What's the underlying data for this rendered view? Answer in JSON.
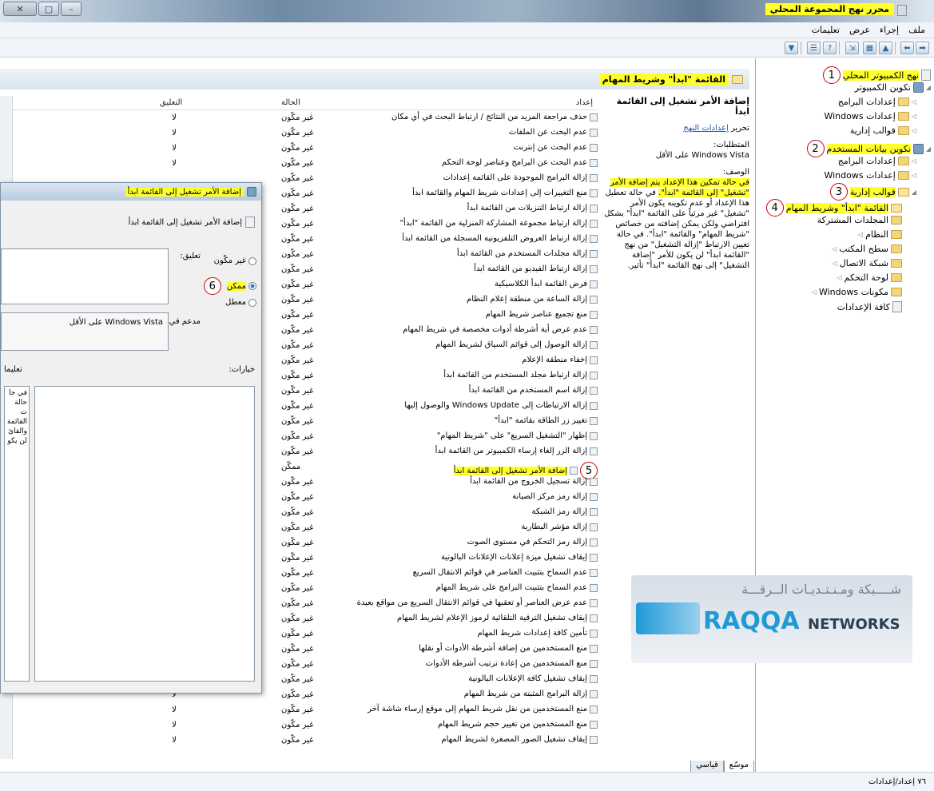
{
  "window": {
    "title": "محرر نهج المجموعة المحلي"
  },
  "menu": [
    "ملف",
    "إجراء",
    "عرض",
    "تعليمات"
  ],
  "tree": [
    {
      "label": "نهج الكمبيوتر المحلي",
      "highlight": true,
      "marker": "1"
    },
    {
      "label": "تكوين الكمبيوتر"
    },
    {
      "label": "إعدادات البرامج"
    },
    {
      "label": "إعدادات Windows"
    },
    {
      "label": "قوالب إدارية"
    },
    {
      "label": "تكوين بيانات المستخدم",
      "highlight": true,
      "marker": "2"
    },
    {
      "label": "إعدادات البرامج"
    },
    {
      "label": "إعدادات Windows"
    },
    {
      "label": "قوالب إدارية",
      "highlight": true,
      "marker": "3"
    },
    {
      "label": "القائمة \"ابدأ\" وشريط المهام",
      "highlight": true,
      "marker": "4"
    },
    {
      "label": "المجلدات المشتركة"
    },
    {
      "label": "النظام"
    },
    {
      "label": "سطح المكتب"
    },
    {
      "label": "شبكة الاتصال"
    },
    {
      "label": "لوحة التحكم"
    },
    {
      "label": "مكونات Windows"
    },
    {
      "label": "كافة الإعدادات"
    }
  ],
  "content": {
    "header_title": "القائمة \"ابدأ\" وشريط المهام",
    "desc": {
      "setting_title": "إضافة الأمر تشغيل إلى القائمة ابدأ",
      "edit_prefix": "تحرير",
      "edit_link": "إعدادات النهج",
      "requirements_label": "المتطلبات:",
      "requirements_value": "Windows Vista على الأقل",
      "description_label": "الوصف:",
      "description_highlight": "في حالة تمكين هذا الإعداد يتم إضافة الأمر \"تشغيل\" إلى القائمة \"ابدأ\".",
      "description_rest": "في حالة تعطيل هذا الإعداد أو عدم تكوينه يكون الأمر \"تشغيل\" غير مرئياً على القائمة \"ابدأ\" بشكل افتراضي ولكن يمكن إضافته من خصائص \"شريط المهام\" والقائمة \"ابدأ\". في حالة تعيين الارتباط \"إزالة التشغيل\" من نهج \"القائمة ابدأ\" لن يكون للأمر \"إضافة التشغيل\" إلى نهج القائمة \"ابدأ\" تأثير."
    },
    "columns": {
      "setting": "إعداد",
      "state": "الحالة",
      "comment": "التعليق"
    },
    "rows": [
      {
        "setting": "حذف مراجعة المزيد من النتائج / ارتباط البحث في أي مكان",
        "state": "غير مكّون",
        "comment": "لا"
      },
      {
        "setting": "عدم البحث عن الملفات",
        "state": "غير مكّون",
        "comment": "لا"
      },
      {
        "setting": "عدم البحث عن إنترنت",
        "state": "غير مكّون",
        "comment": "لا"
      },
      {
        "setting": "عدم البحث عن البرامج وعناصر لوحة التحكم",
        "state": "غير مكّون",
        "comment": "لا"
      },
      {
        "setting": "إزالة البرامج الموجودة على القائمة إعدادات",
        "state": "غير مكّون",
        "comment": ""
      },
      {
        "setting": "منع التغييرات إلى إعدادات شريط المهام والقائمة ابدأ",
        "state": "غير مكّون",
        "comment": ""
      },
      {
        "setting": "إزالة ارتباط التنزيلات من القائمة ابدأ",
        "state": "غير مكّون",
        "comment": ""
      },
      {
        "setting": "إزالة ارتباط مجموعة المشاركة المنزلية من القائمة \"ابدأ\"",
        "state": "غير مكّون",
        "comment": ""
      },
      {
        "setting": "إزالة ارتباط العروض التلفزيونية المسجلة من القائمة ابدأ",
        "state": "غير مكّون",
        "comment": ""
      },
      {
        "setting": "إزالة مجلدات المستخدم من القائمة ابدأ",
        "state": "غير مكّون",
        "comment": ""
      },
      {
        "setting": "إزالة ارتباط الفيديو من القائمة ابدأ",
        "state": "غير مكّون",
        "comment": ""
      },
      {
        "setting": "فرض القائمة ابدأ الكلاسيكية",
        "state": "غير مكّون",
        "comment": ""
      },
      {
        "setting": "إزالة الساعة من منطقة إعلام النظام",
        "state": "غير مكّون",
        "comment": ""
      },
      {
        "setting": "منع تجميع عناصر شريط المهام",
        "state": "غير مكّون",
        "comment": ""
      },
      {
        "setting": "عدم عرض أية أشرطة أدوات مخصصة في شريط المهام",
        "state": "غير مكّون",
        "comment": ""
      },
      {
        "setting": "إزالة الوصول إلى قوائم السياق لشريط المهام",
        "state": "غير مكّون",
        "comment": ""
      },
      {
        "setting": "إخفاء منطقة الإعلام",
        "state": "غير مكّون",
        "comment": ""
      },
      {
        "setting": "إزالة ارتباط مجلد المستخدم من القائمة ابدأ",
        "state": "غير مكّون",
        "comment": ""
      },
      {
        "setting": "إزالة اسم المستخدم من القائمة ابدأ",
        "state": "غير مكّون",
        "comment": ""
      },
      {
        "setting": "إزالة الارتباطات إلى Windows Update والوصول إليها",
        "state": "غير مكّون",
        "comment": ""
      },
      {
        "setting": "تغيير زر الطاقة بقائمة \"ابدأ\"",
        "state": "غير مكّون",
        "comment": ""
      },
      {
        "setting": "إظهار \"التشغيل السريع\" على \"شريط المهام\"",
        "state": "غير مكّون",
        "comment": ""
      },
      {
        "setting": "إزالة الزر إلغاء إرساء الكمبيوتر من القائمة ابدأ",
        "state": "غير مكّون",
        "comment": ""
      },
      {
        "setting": "إضافة الأمر تشغيل إلى القائمة ابدأ",
        "state": "ممكّن",
        "comment": "",
        "highlight": true,
        "marker": "5"
      },
      {
        "setting": "إزالة تسجيل الخروج من القائمة ابدأ",
        "state": "غير مكّون",
        "comment": ""
      },
      {
        "setting": "إزالة رمز مركز الصيانة",
        "state": "غير مكّون",
        "comment": ""
      },
      {
        "setting": "إزالة رمز الشبكة",
        "state": "غير مكّون",
        "comment": ""
      },
      {
        "setting": "إزالة مؤشر البطارية",
        "state": "غير مكّون",
        "comment": ""
      },
      {
        "setting": "إزالة رمز التحكم في مستوى الصوت",
        "state": "غير مكّون",
        "comment": ""
      },
      {
        "setting": "إيقاف تشغيل ميزة إعلانات الإعلانات البالونية",
        "state": "غير مكّون",
        "comment": ""
      },
      {
        "setting": "عدم السماح بتثبيت العناصر في قوائم الانتقال السريع",
        "state": "غير مكّون",
        "comment": ""
      },
      {
        "setting": "عدم السماح بتثبيت البرامج على شريط المهام",
        "state": "غير مكّون",
        "comment": ""
      },
      {
        "setting": "عدم عرض العناصر أو تعقبها في قوائم الانتقال السريع من مواقع بعيدة",
        "state": "غير مكّون",
        "comment": ""
      },
      {
        "setting": "إيقاف تشغيل الترقية التلقائية لرموز الإعلام لشريط المهام",
        "state": "غير مكّون",
        "comment": ""
      },
      {
        "setting": "تأمين كافة إعدادات شريط المهام",
        "state": "غير مكّون",
        "comment": ""
      },
      {
        "setting": "منع المستخدمين من إضافة أشرطة الأدوات أو نقلها",
        "state": "غير مكّون",
        "comment": ""
      },
      {
        "setting": "منع المستخدمين من إعادة ترتيب أشرطة الأدوات",
        "state": "غير مكّون",
        "comment": ""
      },
      {
        "setting": "إيقاف تشغيل كافة الإعلانات البالونية",
        "state": "غير مكّون",
        "comment": ""
      },
      {
        "setting": "إزالة البرامج المثبتة من شريط المهام",
        "state": "غير مكّون",
        "comment": "لا"
      },
      {
        "setting": "منع المستخدمين من نقل شريط المهام إلى موقع إرساء شاشة آخر",
        "state": "غير مكّون",
        "comment": "لا"
      },
      {
        "setting": "منع المستخدمين من تغيير حجم شريط المهام",
        "state": "غير مكّون",
        "comment": "لا"
      },
      {
        "setting": "إيقاف تشغيل الصور المصغرة لشريط المهام",
        "state": "غير مكّون",
        "comment": "لا"
      }
    ],
    "tabs": [
      "موسّع",
      "قياسي"
    ]
  },
  "dialog": {
    "title": "إضافة الأمر تشغيل إلى القائمة ابدأ",
    "header": "إضافة الأمر تشغيل إلى القائمة ابدأ",
    "options": [
      {
        "label": "غير مكّون",
        "checked": false
      },
      {
        "label": "ممكن",
        "checked": true,
        "marker": "6"
      },
      {
        "label": "معطل",
        "checked": false
      }
    ],
    "comment_label": "تعليق:",
    "supported_label": "مدعم في:",
    "supported_value": "Windows Vista على الأقل",
    "options_label": "خيارات:",
    "help_label": "تعليما",
    "help_text": "في حا حالة ت القائمة والقائ لن يكو"
  },
  "watermark": {
    "top": "شــــبكة ومـنـتـديـات الــرقـــة",
    "brand": "RAQQA",
    "brand_suffix": "NETWORKS"
  },
  "status": "٧٦ إعداد/إعدادات"
}
